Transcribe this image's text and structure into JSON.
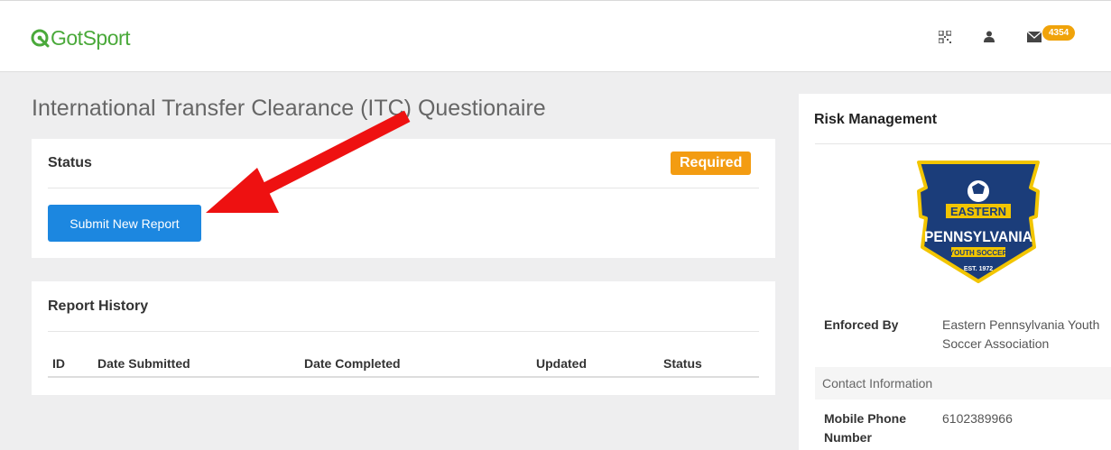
{
  "brand": {
    "name": "GotSport",
    "color": "#4aa93a"
  },
  "header": {
    "icons": [
      "qr-code-icon",
      "user-icon",
      "envelope-icon"
    ],
    "mail_count": "4354"
  },
  "page": {
    "title": "International Transfer Clearance (ITC) Questionaire"
  },
  "status_card": {
    "title": "Status",
    "badge": "Required",
    "button_label": "Submit New Report"
  },
  "history_card": {
    "title": "Report History",
    "columns": [
      "ID",
      "Date Submitted",
      "Date Completed",
      "Updated",
      "Status"
    ]
  },
  "risk_card": {
    "title": "Risk Management",
    "crest": {
      "line1": "EASTERN",
      "line2": "PENNSYLVANIA",
      "line3": "YOUTH SOCCER",
      "line4": "EST. 1972"
    },
    "enforced_by_label": "Enforced By",
    "enforced_by_value_line1": "Eastern Pennsylvania Youth",
    "enforced_by_value_line2": "Soccer Association",
    "contact_header": "Contact Information",
    "mobile_label_line1": "Mobile Phone",
    "mobile_label_line2": "Number",
    "mobile_value": "6102389966"
  },
  "colors": {
    "primary": "#1c87e0",
    "warning": "#f39c12",
    "annotation_arrow": "#ee1111"
  }
}
